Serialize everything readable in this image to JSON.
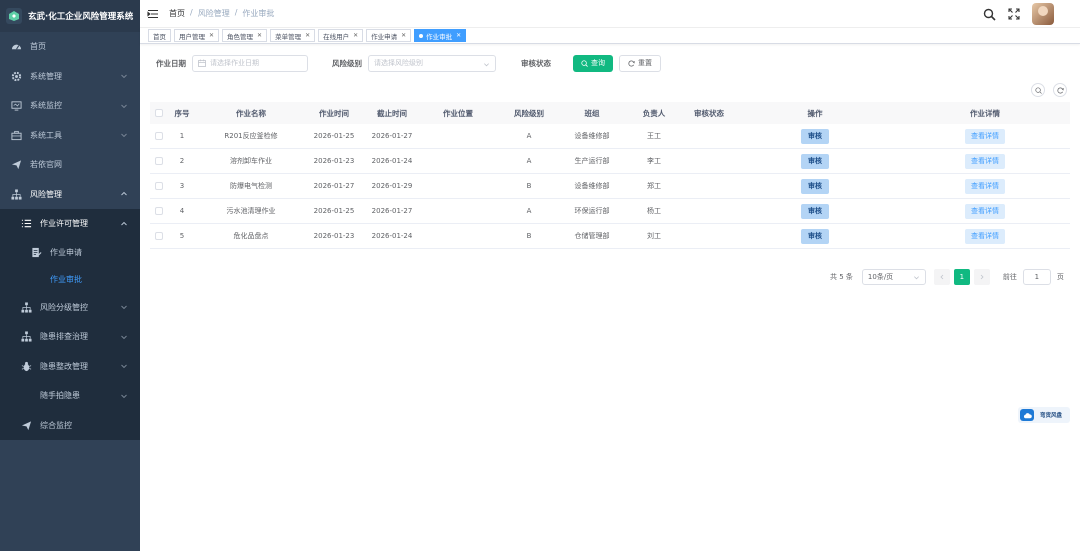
{
  "app": {
    "title": "玄武·化工企业风险管理系统"
  },
  "sidebar": {
    "items": [
      {
        "label": "首页",
        "icon": "dashboard-icon"
      },
      {
        "label": "系统管理",
        "icon": "gear-icon"
      },
      {
        "label": "系统监控",
        "icon": "monitor-icon"
      },
      {
        "label": "系统工具",
        "icon": "toolbox-icon"
      },
      {
        "label": "若依官网",
        "icon": "paper-plane-icon"
      },
      {
        "label": "风险管理",
        "icon": "tree-icon"
      }
    ],
    "risk_sub": [
      {
        "label": "作业许可管理",
        "icon": "list-icon"
      },
      {
        "label": "作业申请",
        "icon": "form-icon"
      },
      {
        "label": "作业审批",
        "icon": ""
      },
      {
        "label": "风险分级管控",
        "icon": "tree-icon"
      },
      {
        "label": "隐患排查治理",
        "icon": "tree-icon"
      },
      {
        "label": "隐患整改管理",
        "icon": "bug-icon"
      },
      {
        "label": "随手拍隐患",
        "icon": ""
      },
      {
        "label": "综合监控",
        "icon": "paper-plane-icon"
      }
    ]
  },
  "header": {
    "breadcrumb": [
      "首页",
      "/",
      "风险管理",
      "/",
      "作业审批"
    ]
  },
  "tags": [
    {
      "label": "首页",
      "closable": false
    },
    {
      "label": "用户管理",
      "closable": true
    },
    {
      "label": "角色管理",
      "closable": true
    },
    {
      "label": "菜单管理",
      "closable": true
    },
    {
      "label": "在线用户",
      "closable": true
    },
    {
      "label": "作业申请",
      "closable": true
    },
    {
      "label": "作业审批",
      "closable": true,
      "active": true
    }
  ],
  "search": {
    "date_label": "作业日期",
    "date_placeholder": "请选择作业日期",
    "level_label": "风险级别",
    "level_placeholder": "请选择风险级别",
    "status_label": "审核状态",
    "query_label": "查询",
    "reset_label": "重置"
  },
  "table": {
    "columns": [
      "序号",
      "作业名称",
      "作业时间",
      "截止时间",
      "作业位置",
      "风险级别",
      "班组",
      "负责人",
      "审核状态",
      "操作",
      "作业详情"
    ],
    "rows": [
      {
        "no": "1",
        "name": "R201反应釜检修",
        "start": "2026-01-25",
        "end": "2026-01-27",
        "location": "",
        "level": "A",
        "team": "设备维修部",
        "owner": "王工",
        "status": ""
      },
      {
        "no": "2",
        "name": "溶剂卸车作业",
        "start": "2026-01-23",
        "end": "2026-01-24",
        "location": "",
        "level": "A",
        "team": "生产运行部",
        "owner": "李工",
        "status": ""
      },
      {
        "no": "3",
        "name": "防爆电气检测",
        "start": "2026-01-27",
        "end": "2026-01-29",
        "location": "",
        "level": "B",
        "team": "设备维修部",
        "owner": "郑工",
        "status": ""
      },
      {
        "no": "4",
        "name": "污水池清理作业",
        "start": "2026-01-25",
        "end": "2026-01-27",
        "location": "",
        "level": "A",
        "team": "环保运行部",
        "owner": "杨工",
        "status": ""
      },
      {
        "no": "5",
        "name": "危化品盘点",
        "start": "2026-01-23",
        "end": "2026-01-24",
        "location": "",
        "level": "B",
        "team": "仓储管理部",
        "owner": "刘工",
        "status": ""
      }
    ],
    "audit_label": "审核",
    "detail_label": "查看详情"
  },
  "pagination": {
    "total_prefix": "共 5 条",
    "page_size": "10条/页",
    "current": "1",
    "goto_label": "前往",
    "goto_value": "1",
    "page_suffix": "页"
  },
  "float_widget": {
    "label": "弯货风盘"
  },
  "colors": {
    "sidebar": "#304156",
    "primary": "#11b981",
    "active": "#409eff"
  }
}
